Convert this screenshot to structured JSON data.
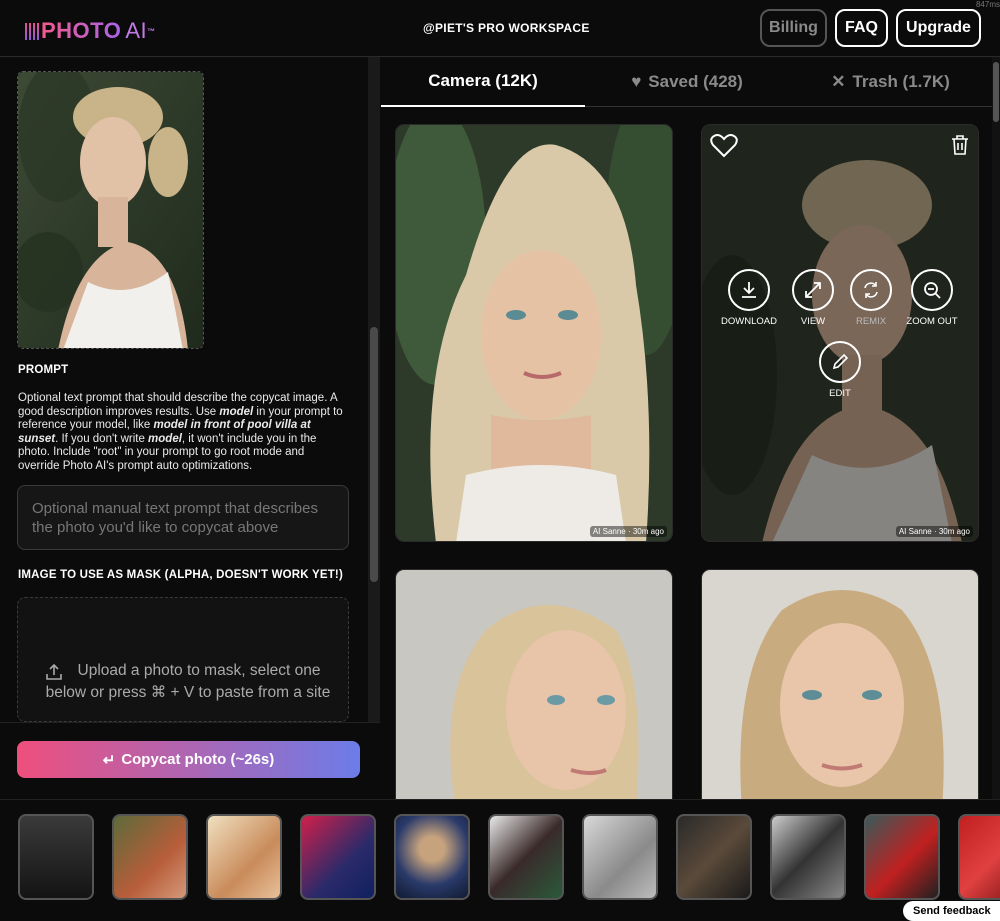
{
  "header": {
    "logo_photo": "PHOTO",
    "logo_ai": "AI",
    "logo_tm": "™",
    "workspace": "@PIET'S PRO WORKSPACE",
    "corner_text": "847ms",
    "billing": "Billing",
    "faq": "FAQ",
    "upgrade": "Upgrade"
  },
  "left": {
    "prompt_label": "PROMPT",
    "help_1": "Optional text prompt that should describe the copycat image. A good description improves results. Use ",
    "help_model": "model",
    "help_2": " in your prompt to reference your model, like ",
    "help_example": "model in front of pool villa at sunset",
    "help_3": ". If you don't write ",
    "help_model2": "model",
    "help_4": ", it won't include you in the photo. Include \"root\" in your prompt to go root mode and override Photo AI's prompt auto optimizations.",
    "prompt_placeholder": "Optional manual text prompt that describes the photo you'd like to copycat above",
    "mask_label": "IMAGE TO USE AS MASK (ALPHA, DOESN'T WORK YET!)",
    "mask_text": "Upload a photo to mask, select one below or press ⌘ + V to paste from a site",
    "copycat_button": "Copycat photo (~26s)",
    "copycat_icon": "↵"
  },
  "tabs": {
    "camera": "Camera (12K)",
    "saved": "Saved (428)",
    "trash": "Trash (1.7K)"
  },
  "cards": {
    "credit": "AI Sanne",
    "time": "30m ago",
    "actions": {
      "download": "DOWNLOAD",
      "view": "VIEW",
      "remix": "REMIX",
      "zoom_out": "ZOOM OUT",
      "edit": "EDIT"
    }
  },
  "feedback": "Send feedback",
  "colors": {
    "accent_pink": "#ef4f7d",
    "accent_blue": "#6c7ce8",
    "background": "#0b0b0b"
  }
}
